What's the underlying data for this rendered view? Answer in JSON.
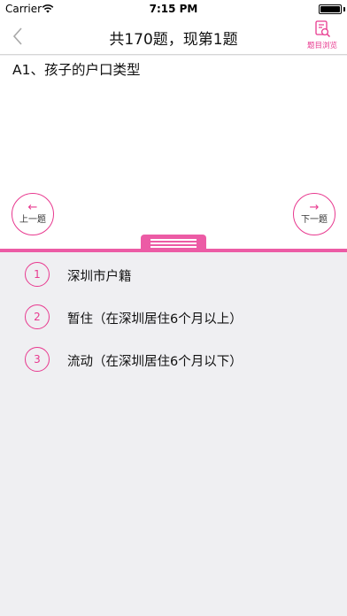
{
  "status": {
    "carrier": "Carrier",
    "time": "7:15 PM"
  },
  "nav": {
    "title": "共170题，现第1题",
    "browse_label": "题目浏览"
  },
  "question": {
    "text": "A1、孩子的户口类型"
  },
  "controls": {
    "prev_label": "上一题",
    "next_label": "下一题",
    "prev_arrow": "←",
    "next_arrow": "→"
  },
  "options": [
    {
      "num": "1",
      "text": "深圳市户籍"
    },
    {
      "num": "2",
      "text": "暂住（在深圳居住6个月以上）"
    },
    {
      "num": "3",
      "text": "流动（在深圳居住6个月以下）"
    }
  ],
  "colors": {
    "accent": "#e8398f",
    "bar": "#ec5ba5",
    "background": "#efeff2"
  }
}
